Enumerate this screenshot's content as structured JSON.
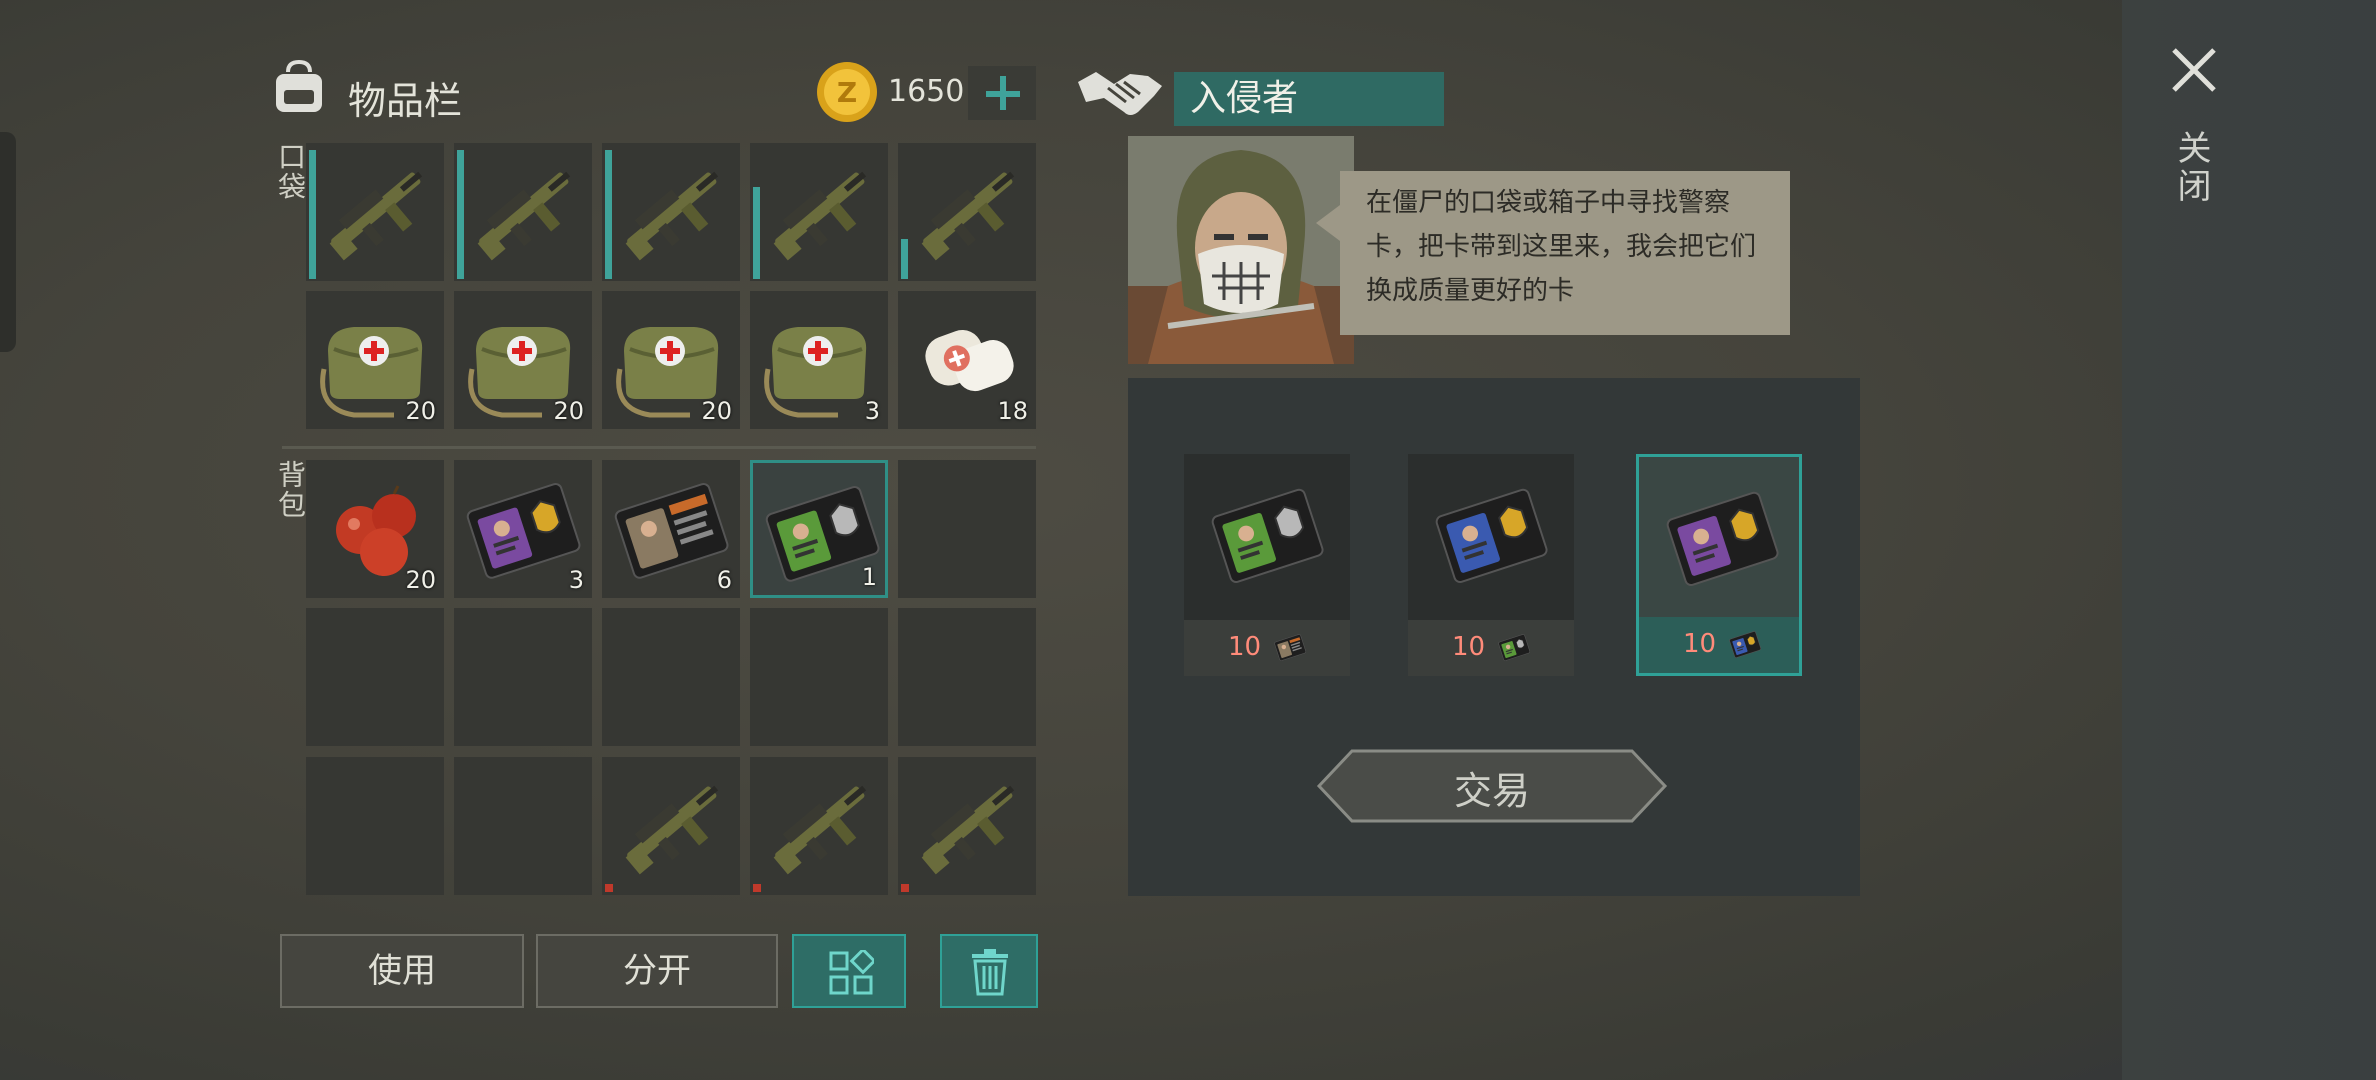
{
  "inventory": {
    "title": "物品栏",
    "coins": "1650",
    "pockets_label": "口袋",
    "backpack_label": "背包",
    "pockets": [
      {
        "icon": "rifle-icon",
        "fill": 0.98
      },
      {
        "icon": "rifle-icon",
        "fill": 0.98
      },
      {
        "icon": "rifle-icon",
        "fill": 0.98
      },
      {
        "icon": "rifle-icon",
        "fill": 0.7
      },
      {
        "icon": "rifle-icon",
        "fill": 0.3
      },
      {
        "icon": "medkit-bag-icon",
        "count": "20"
      },
      {
        "icon": "medkit-bag-icon",
        "count": "20"
      },
      {
        "icon": "medkit-bag-icon",
        "count": "20"
      },
      {
        "icon": "medkit-bag-icon",
        "count": "3"
      },
      {
        "icon": "bandage-icon",
        "count": "18"
      }
    ],
    "backpack": [
      {
        "icon": "apples-icon",
        "count": "20"
      },
      {
        "icon": "police-card-purple-icon",
        "count": "3"
      },
      {
        "icon": "patrol-officer-card-icon",
        "count": "6"
      },
      {
        "icon": "police-card-green-icon",
        "count": "1",
        "selected": true
      },
      {
        "icon": "empty"
      },
      {
        "icon": "empty"
      },
      {
        "icon": "empty"
      },
      {
        "icon": "empty"
      },
      {
        "icon": "empty"
      },
      {
        "icon": "empty"
      },
      {
        "icon": "empty"
      },
      {
        "icon": "empty"
      },
      {
        "icon": "rifle-icon",
        "broken": true
      },
      {
        "icon": "rifle-icon",
        "broken": true
      },
      {
        "icon": "rifle-icon",
        "broken": true
      }
    ],
    "buttons": {
      "use": "使用",
      "split": "分开"
    }
  },
  "trader": {
    "name": "入侵者",
    "message": "在僵尸的口袋或箱子中寻找警察卡，把卡带到这里来，我会把它们换成质量更好的卡",
    "offers": [
      {
        "icon": "police-card-green-icon",
        "cost": "10",
        "cost_icon": "patrol-officer-card-icon"
      },
      {
        "icon": "police-card-blue-icon",
        "cost": "10",
        "cost_icon": "police-card-green-icon"
      },
      {
        "icon": "police-card-purple-icon",
        "cost": "10",
        "cost_icon": "police-card-blue-icon",
        "selected": true
      }
    ],
    "trade_label": "交易"
  },
  "close_label": "关闭",
  "colors": {
    "accent": "#2fa197",
    "panel": "#333838",
    "slot": "#363733",
    "cost_red": "#ff8b7a"
  }
}
